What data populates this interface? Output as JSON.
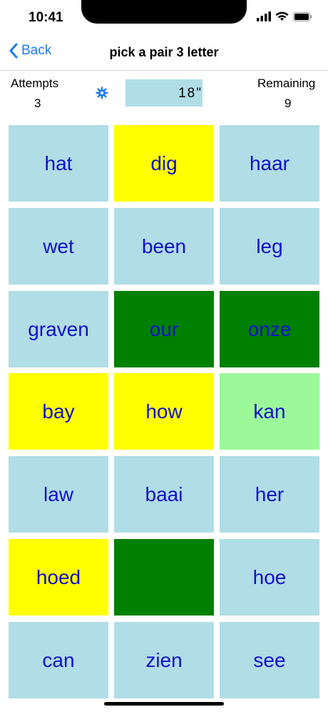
{
  "status": {
    "time": "10:41"
  },
  "nav": {
    "back_label": "Back",
    "title": "pick a pair 3 letter"
  },
  "stats": {
    "attempts_label": "Attempts",
    "attempts_value": "3",
    "remaining_label": "Remaining",
    "remaining_value": "9",
    "timer": "18\""
  },
  "tiles": [
    {
      "text": "hat",
      "color": "#b0dde6"
    },
    {
      "text": "dig",
      "color": "#ffff00"
    },
    {
      "text": "haar",
      "color": "#b0dde6"
    },
    {
      "text": "wet",
      "color": "#b0dde6"
    },
    {
      "text": "been",
      "color": "#b0dde6"
    },
    {
      "text": "leg",
      "color": "#b0dde6"
    },
    {
      "text": "graven",
      "color": "#b0dde6"
    },
    {
      "text": "our",
      "color": "#008000"
    },
    {
      "text": "onze",
      "color": "#008000"
    },
    {
      "text": "bay",
      "color": "#ffff00"
    },
    {
      "text": "how",
      "color": "#ffff00"
    },
    {
      "text": "kan",
      "color": "#9cf99a"
    },
    {
      "text": "law",
      "color": "#b0dde6"
    },
    {
      "text": "baai",
      "color": "#b0dde6"
    },
    {
      "text": "her",
      "color": "#b0dde6"
    },
    {
      "text": "hoed",
      "color": "#ffff00"
    },
    {
      "text": "",
      "color": "#008000"
    },
    {
      "text": "hoe",
      "color": "#b0dde6"
    },
    {
      "text": "can",
      "color": "#b0dde6"
    },
    {
      "text": "zien",
      "color": "#b0dde6"
    },
    {
      "text": "see",
      "color": "#b0dde6"
    }
  ],
  "colors": {
    "accent": "#1a7cf5",
    "tile_text": "#1010cc"
  }
}
